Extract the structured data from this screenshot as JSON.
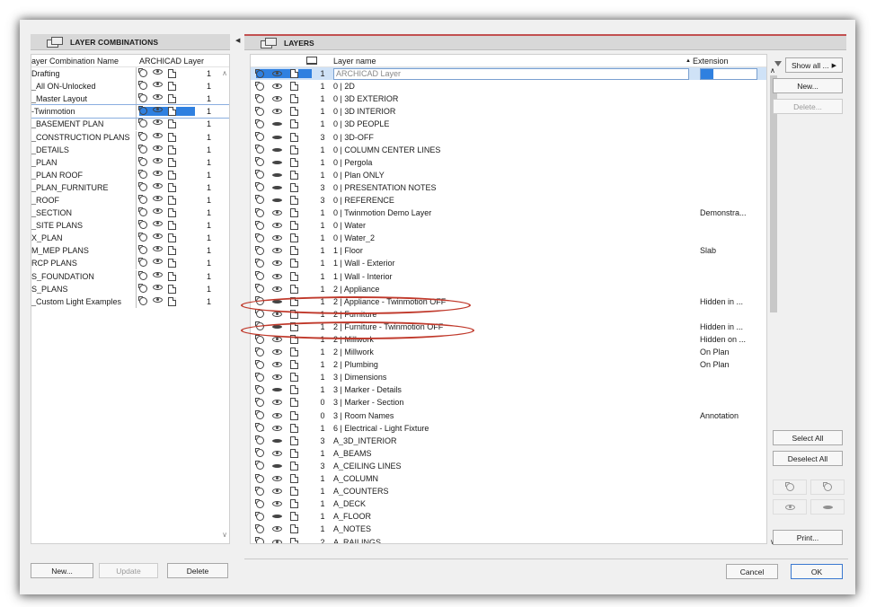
{
  "left_panel": {
    "title": "LAYER COMBINATIONS",
    "col_name": "ayer Combination Name",
    "col_layer": "ARCHICAD Layer",
    "rows": [
      {
        "name": "Drafting",
        "count": "1"
      },
      {
        "name": "_All ON-Unlocked",
        "count": "1"
      },
      {
        "name": "_Master Layout",
        "count": "1"
      },
      {
        "name": "-Twinmotion",
        "count": "1",
        "selected": true
      },
      {
        "name": "_BASEMENT PLAN",
        "count": "1"
      },
      {
        "name": "_CONSTRUCTION PLANS",
        "count": "1"
      },
      {
        "name": "_DETAILS",
        "count": "1"
      },
      {
        "name": "_PLAN",
        "count": "1"
      },
      {
        "name": "_PLAN ROOF",
        "count": "1"
      },
      {
        "name": "_PLAN_FURNITURE",
        "count": "1"
      },
      {
        "name": "_ROOF",
        "count": "1"
      },
      {
        "name": "_SECTION",
        "count": "1"
      },
      {
        "name": "_SITE PLANS",
        "count": "1"
      },
      {
        "name": "X_PLAN",
        "count": "1"
      },
      {
        "name": "M_MEP PLANS",
        "count": "1"
      },
      {
        "name": "RCP PLANS",
        "count": "1"
      },
      {
        "name": "S_FOUNDATION",
        "count": "1"
      },
      {
        "name": "S_PLANS",
        "count": "1"
      },
      {
        "name": "_Custom Light Examples",
        "count": "1"
      }
    ],
    "buttons": {
      "new": "New...",
      "update": "Update",
      "delete": "Delete"
    }
  },
  "right_panel": {
    "title": "LAYERS",
    "col_name": "Layer name",
    "col_ext": "Extension",
    "rows": [
      {
        "num": "1",
        "name": "ARCHICAD Layer",
        "ext": "",
        "selected": true,
        "eye": "open"
      },
      {
        "num": "1",
        "name": "0 | 2D",
        "ext": "",
        "eye": "open"
      },
      {
        "num": "1",
        "name": "0 | 3D EXTERIOR",
        "ext": "",
        "eye": "open"
      },
      {
        "num": "1",
        "name": "0 | 3D INTERIOR",
        "ext": "",
        "eye": "open"
      },
      {
        "num": "1",
        "name": "0 | 3D PEOPLE",
        "ext": "",
        "eye": "closed"
      },
      {
        "num": "3",
        "name": "0 | 3D-OFF",
        "ext": "",
        "eye": "closed"
      },
      {
        "num": "1",
        "name": "0 | COLUMN CENTER LINES",
        "ext": "",
        "eye": "closed"
      },
      {
        "num": "1",
        "name": "0 | Pergola",
        "ext": "",
        "eye": "closed"
      },
      {
        "num": "1",
        "name": "0 | Plan ONLY",
        "ext": "",
        "eye": "closed"
      },
      {
        "num": "3",
        "name": "0 | PRESENTATION NOTES",
        "ext": "",
        "eye": "closed"
      },
      {
        "num": "3",
        "name": "0 | REFERENCE",
        "ext": "",
        "eye": "closed"
      },
      {
        "num": "1",
        "name": "0 | Twinmotion Demo Layer",
        "ext": "Demonstra...",
        "eye": "open"
      },
      {
        "num": "1",
        "name": "0 | Water",
        "ext": "",
        "eye": "open"
      },
      {
        "num": "1",
        "name": "0 | Water_2",
        "ext": "",
        "eye": "open"
      },
      {
        "num": "1",
        "name": "1 | Floor",
        "ext": "Slab",
        "eye": "open"
      },
      {
        "num": "1",
        "name": "1 | Wall - Exterior",
        "ext": "",
        "eye": "open"
      },
      {
        "num": "1",
        "name": "1 | Wall - Interior",
        "ext": "",
        "eye": "open"
      },
      {
        "num": "1",
        "name": "2 | Appliance",
        "ext": "",
        "eye": "open"
      },
      {
        "num": "1",
        "name": "2 | Appliance - Twinmotion OFF",
        "ext": "Hidden in ...",
        "eye": "closed"
      },
      {
        "num": "1",
        "name": "2 | Furniture",
        "ext": "",
        "eye": "open"
      },
      {
        "num": "1",
        "name": "2 | Furniture - Twinmotion OFF",
        "ext": "Hidden in ...",
        "eye": "closed"
      },
      {
        "num": "1",
        "name": "2 | Millwork",
        "ext": "Hidden on ...",
        "eye": "open"
      },
      {
        "num": "1",
        "name": "2 | Millwork",
        "ext": "On Plan",
        "eye": "open"
      },
      {
        "num": "1",
        "name": "2 | Plumbing",
        "ext": "On Plan",
        "eye": "open"
      },
      {
        "num": "1",
        "name": "3 | Dimensions",
        "ext": "",
        "eye": "open"
      },
      {
        "num": "1",
        "name": "3 | Marker - Details",
        "ext": "",
        "eye": "closed"
      },
      {
        "num": "0",
        "name": "3 | Marker - Section",
        "ext": "",
        "eye": "open"
      },
      {
        "num": "0",
        "name": "3 | Room Names",
        "ext": "Annotation",
        "eye": "open"
      },
      {
        "num": "1",
        "name": "6 | Electrical - Light Fixture",
        "ext": "",
        "eye": "open"
      },
      {
        "num": "3",
        "name": "A_3D_INTERIOR",
        "ext": "",
        "eye": "closed"
      },
      {
        "num": "1",
        "name": "A_BEAMS",
        "ext": "",
        "eye": "open"
      },
      {
        "num": "3",
        "name": "A_CEILING LINES",
        "ext": "",
        "eye": "closed"
      },
      {
        "num": "1",
        "name": "A_COLUMN",
        "ext": "",
        "eye": "open"
      },
      {
        "num": "1",
        "name": "A_COUNTERS",
        "ext": "",
        "eye": "open"
      },
      {
        "num": "1",
        "name": "A_DECK",
        "ext": "",
        "eye": "open"
      },
      {
        "num": "1",
        "name": "A_FLOOR",
        "ext": "",
        "eye": "closed"
      },
      {
        "num": "1",
        "name": "A_NOTES",
        "ext": "",
        "eye": "open"
      },
      {
        "num": "2",
        "name": "A_RAILINGS",
        "ext": "",
        "eye": "open"
      }
    ],
    "buttons": {
      "show_all": "Show all ...",
      "new": "New...",
      "delete": "Delete...",
      "select_all": "Select All",
      "deselect_all": "Deselect All",
      "print": "Print...",
      "cancel": "Cancel",
      "ok": "OK"
    }
  },
  "colors": {
    "accent": "#2f80e0",
    "highlight": "#c0392b"
  }
}
